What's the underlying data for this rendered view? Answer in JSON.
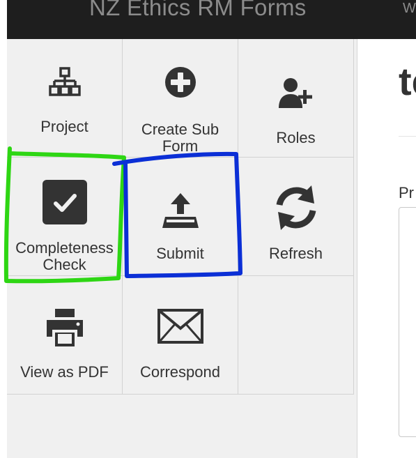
{
  "navbar": {
    "brand": "NZ Ethics RM Forms",
    "nav_item": "We"
  },
  "sidebar": {
    "actions": [
      {
        "id": "project",
        "label_lines": [
          "Project"
        ],
        "icon": "sitemap-icon"
      },
      {
        "id": "create-sub-form",
        "label_lines": [
          "Create Sub",
          "Form"
        ],
        "icon": "plus-circle-icon"
      },
      {
        "id": "roles",
        "label_lines": [
          "Roles"
        ],
        "icon": "user-plus-icon"
      },
      {
        "id": "completeness-check",
        "label_lines": [
          "Completeness",
          "Check"
        ],
        "icon": "checkbox-icon"
      },
      {
        "id": "submit",
        "label_lines": [
          "Submit"
        ],
        "icon": "upload-icon"
      },
      {
        "id": "refresh",
        "label_lines": [
          "Refresh"
        ],
        "icon": "refresh-icon"
      },
      {
        "id": "view-as-pdf",
        "label_lines": [
          "View as PDF"
        ],
        "icon": "print-icon"
      },
      {
        "id": "correspond",
        "label_lines": [
          "Correspond"
        ],
        "icon": "envelope-icon"
      }
    ]
  },
  "main": {
    "heading": "te",
    "field_label": "Pr"
  },
  "annotations": {
    "green_box_color": "#2ed614",
    "blue_box_color": "#0b2fd6"
  },
  "colors": {
    "navbar_bg": "#1e1e1e",
    "sidebar_bg": "#f0f0f0",
    "icon": "#333333"
  }
}
